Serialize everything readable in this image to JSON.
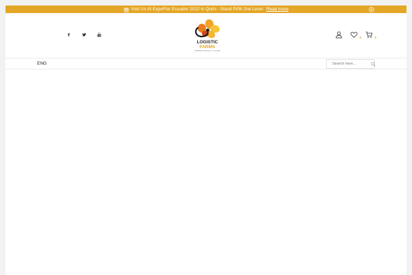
{
  "announcement": {
    "message": "Visit Us At ExpoFlor Ecuador 2022 in Quito - Stand P/06 2nd Level",
    "link_text": "Read more",
    "bar_color": "#e4a626",
    "icons": {
      "leading": "gift-icon",
      "close": "close-icon"
    }
  },
  "header": {
    "socials": [
      {
        "name": "facebook-icon"
      },
      {
        "name": "twitter-icon"
      },
      {
        "name": "youtube-icon"
      }
    ],
    "logo": {
      "line1": "LOGISTIC",
      "line2": "FARMS",
      "tagline": "FRESHNESS FROM FIELD TO FLOWER"
    },
    "actions": {
      "account_icon": "user-icon",
      "wishlist_icon": "heart-icon",
      "wishlist_count": "0",
      "cart_icon": "cart-icon",
      "cart_count": "0"
    }
  },
  "nav": {
    "language": "ENG",
    "search": {
      "placeholder": "Search here...",
      "icon": "search-icon"
    }
  }
}
